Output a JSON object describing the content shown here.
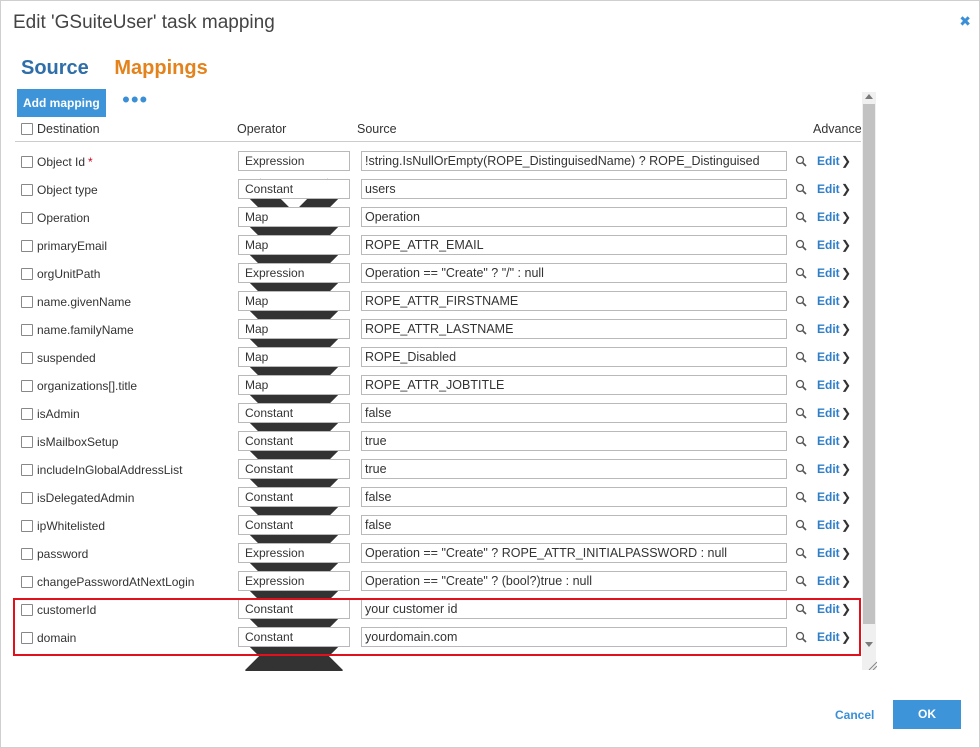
{
  "dialog": {
    "title": "Edit 'GSuiteUser' task mapping",
    "close_icon": "close-icon"
  },
  "tabs": [
    {
      "label": "Source"
    },
    {
      "label": "Mappings"
    }
  ],
  "toolbar": {
    "add_label": "Add mapping",
    "more_label": "•••"
  },
  "columns": {
    "destination": "Destination",
    "operator": "Operator",
    "source": "Source",
    "advanced": "Advance"
  },
  "rows": [
    {
      "dest": "Object Id",
      "required": "*",
      "op": "Expression",
      "src": "!string.IsNullOrEmpty(ROPE_DistinguisedName) ? ROPE_Distinguised"
    },
    {
      "dest": "Object type",
      "required": "",
      "op": "Constant",
      "src": "users"
    },
    {
      "dest": "Operation",
      "required": "",
      "op": "Map",
      "src": "Operation"
    },
    {
      "dest": "primaryEmail",
      "required": "",
      "op": "Map",
      "src": "ROPE_ATTR_EMAIL"
    },
    {
      "dest": "orgUnitPath",
      "required": "",
      "op": "Expression",
      "src": "Operation == \"Create\" ? \"/\" : null"
    },
    {
      "dest": "name.givenName",
      "required": "",
      "op": "Map",
      "src": "ROPE_ATTR_FIRSTNAME"
    },
    {
      "dest": "name.familyName",
      "required": "",
      "op": "Map",
      "src": "ROPE_ATTR_LASTNAME"
    },
    {
      "dest": "suspended",
      "required": "",
      "op": "Map",
      "src": "ROPE_Disabled"
    },
    {
      "dest": "organizations[].title",
      "required": "",
      "op": "Map",
      "src": "ROPE_ATTR_JOBTITLE"
    },
    {
      "dest": "isAdmin",
      "required": "",
      "op": "Constant",
      "src": "false"
    },
    {
      "dest": "isMailboxSetup",
      "required": "",
      "op": "Constant",
      "src": "true"
    },
    {
      "dest": "includeInGlobalAddressList",
      "required": "",
      "op": "Constant",
      "src": "true"
    },
    {
      "dest": "isDelegatedAdmin",
      "required": "",
      "op": "Constant",
      "src": "false"
    },
    {
      "dest": "ipWhitelisted",
      "required": "",
      "op": "Constant",
      "src": "false"
    },
    {
      "dest": "password",
      "required": "",
      "op": "Expression",
      "src": "Operation == \"Create\" ? ROPE_ATTR_INITIALPASSWORD : null"
    },
    {
      "dest": "changePasswordAtNextLogin",
      "required": "",
      "op": "Expression",
      "src": "Operation == \"Create\" ? (bool?)true : null"
    },
    {
      "dest": "customerId",
      "required": "",
      "op": "Constant",
      "src": "your customer id"
    },
    {
      "dest": "domain",
      "required": "",
      "op": "Constant",
      "src": "yourdomain.com"
    }
  ],
  "row_actions": {
    "edit_label": "Edit",
    "arrow_label": "❯"
  },
  "footer": {
    "cancel_label": "Cancel",
    "ok_label": "OK"
  },
  "colors": {
    "accent": "#3d94d8",
    "source_tab": "#2f6ea8",
    "mappings_tab": "#e4821c",
    "highlight": "#e0101c"
  }
}
